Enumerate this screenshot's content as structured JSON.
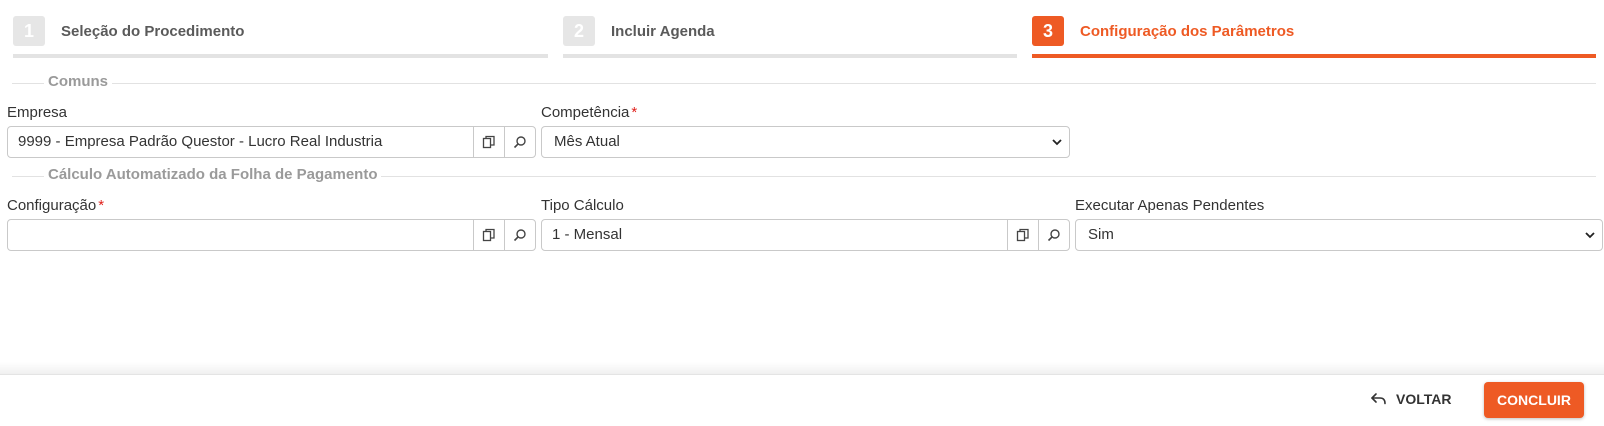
{
  "steps": [
    {
      "number": "1",
      "label": "Seleção do Procedimento"
    },
    {
      "number": "2",
      "label": "Incluir Agenda"
    },
    {
      "number": "3",
      "label": "Configuração dos Parâmetros"
    }
  ],
  "sections": {
    "comuns": "Comuns",
    "calculo": "Cálculo Automatizado da Folha de Pagamento"
  },
  "fields": {
    "empresa": {
      "label": "Empresa",
      "value": "9999 - Empresa Padrão Questor - Lucro Real Industria"
    },
    "competencia": {
      "label": "Competência",
      "required": "*",
      "value": "Mês Atual"
    },
    "configuracao": {
      "label": "Configuração",
      "required": "*",
      "value": ""
    },
    "tipo_calculo": {
      "label": "Tipo Cálculo",
      "value": "1 - Mensal"
    },
    "executar_pendentes": {
      "label": "Executar Apenas Pendentes",
      "value": "Sim"
    }
  },
  "footer": {
    "back_label": "VOLTAR",
    "conclude_label": "CONCLUIR"
  },
  "colors": {
    "accent": "#ee5a24",
    "required": "#e0201b",
    "inactive_step": "#e6e6e6"
  }
}
